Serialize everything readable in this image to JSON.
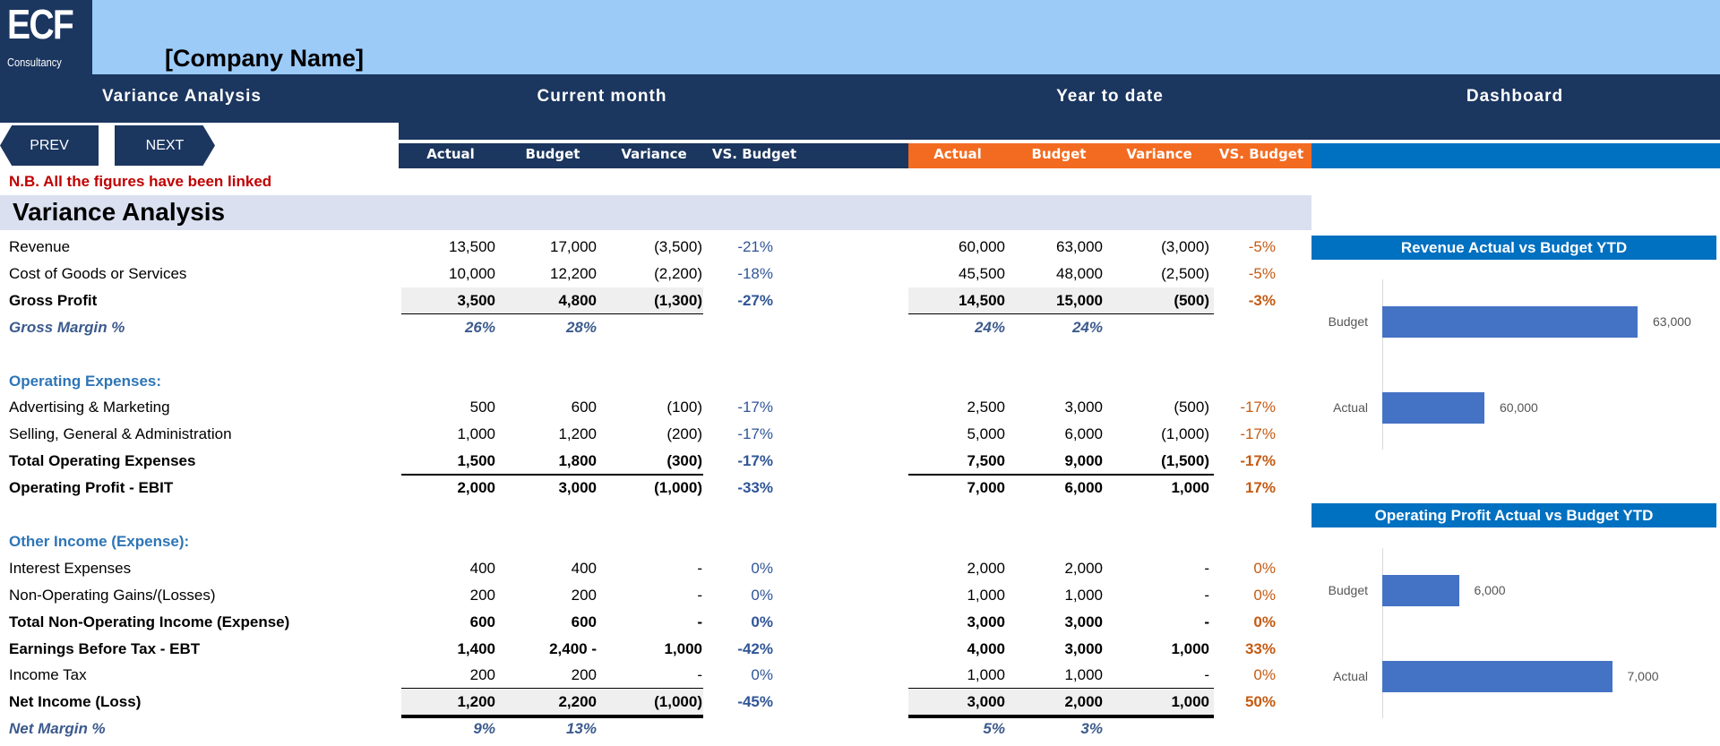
{
  "logo": {
    "big": "ECF",
    "small": "Consultancy"
  },
  "company_name": "[Company Name]",
  "nav": {
    "variance_analysis": "Variance Analysis",
    "current_month": "Current month",
    "year_to_date": "Year to date",
    "dashboard": "Dashboard"
  },
  "buttons": {
    "prev": "PREV",
    "next": "NEXT"
  },
  "column_headers": {
    "current_month": [
      "Actual",
      "Budget",
      "Variance",
      "VS. Budget"
    ],
    "year_to_date": [
      "Actual",
      "Budget",
      "Variance",
      "VS. Budget"
    ]
  },
  "note": "N.B. All the figures have been linked",
  "section_title": "Variance Analysis",
  "colors": {
    "navy": "#1b365f",
    "orange": "#f26b21",
    "blue": "#0070c0",
    "bar": "#4472c4",
    "note_red": "#c00000"
  },
  "rows": [
    {
      "label": "Revenue",
      "style": "normal",
      "cm": [
        "13,500",
        "17,000",
        "(3,500)",
        "-21%"
      ],
      "ytd": [
        "60,000",
        "63,000",
        "(3,000)",
        "-5%"
      ]
    },
    {
      "label": "Cost of Goods or Services",
      "style": "normal",
      "cm": [
        "10,000",
        "12,200",
        "(2,200)",
        "-18%"
      ],
      "ytd": [
        "45,500",
        "48,000",
        "(2,500)",
        "-5%"
      ]
    },
    {
      "label": "Gross Profit",
      "style": "bold",
      "shade": true,
      "underline": "single",
      "cm": [
        "3,500",
        "4,800",
        "(1,300)",
        "-27%"
      ],
      "ytd": [
        "14,500",
        "15,000",
        "(500)",
        "-3%"
      ]
    },
    {
      "label": "Gross Margin %",
      "style": "margin",
      "cm": [
        "26%",
        "28%",
        "",
        ""
      ],
      "ytd": [
        "24%",
        "24%",
        "",
        ""
      ]
    },
    {
      "label": "",
      "style": "blank"
    },
    {
      "label": "Operating Expenses:",
      "style": "section-hdr"
    },
    {
      "label": "Advertising & Marketing",
      "style": "normal",
      "cm": [
        "500",
        "600",
        "(100)",
        "-17%"
      ],
      "ytd": [
        "2,500",
        "3,000",
        "(500)",
        "-17%"
      ]
    },
    {
      "label": "Selling, General & Administration",
      "style": "normal",
      "cm": [
        "1,000",
        "1,200",
        "(200)",
        "-17%"
      ],
      "ytd": [
        "5,000",
        "6,000",
        "(1,000)",
        "-17%"
      ]
    },
    {
      "label": "Total Operating Expenses",
      "style": "bold",
      "underline": "single",
      "cm": [
        "1,500",
        "1,800",
        "(300)",
        "-17%"
      ],
      "ytd": [
        "7,500",
        "9,000",
        "(1,500)",
        "-17%"
      ]
    },
    {
      "label": "Operating Profit - EBIT",
      "style": "bold",
      "cm": [
        "2,000",
        "3,000",
        "(1,000)",
        "-33%"
      ],
      "ytd": [
        "7,000",
        "6,000",
        "1,000",
        "17%"
      ]
    },
    {
      "label": "",
      "style": "blank"
    },
    {
      "label": "Other Income (Expense):",
      "style": "section-hdr"
    },
    {
      "label": "Interest Expenses",
      "style": "normal",
      "cm": [
        "400",
        "400",
        "-",
        "0%"
      ],
      "ytd": [
        "2,000",
        "2,000",
        "-",
        "0%"
      ]
    },
    {
      "label": "Non-Operating Gains/(Losses)",
      "style": "normal",
      "cm": [
        "200",
        "200",
        "-",
        "0%"
      ],
      "ytd": [
        "1,000",
        "1,000",
        "-",
        "0%"
      ]
    },
    {
      "label": "Total Non-Operating Income (Expense)",
      "style": "bold",
      "cm": [
        "600",
        "600",
        "-",
        "0%"
      ],
      "ytd": [
        "3,000",
        "3,000",
        "-",
        "0%"
      ]
    },
    {
      "label": "Earnings Before Tax - EBT",
      "style": "bold",
      "cm": [
        "1,400",
        "2,400 -",
        "1,000",
        "-42%"
      ],
      "ytd": [
        "4,000",
        "3,000",
        "1,000",
        "33%"
      ]
    },
    {
      "label": "Income Tax",
      "style": "normal",
      "underline": "single",
      "cm": [
        "200",
        "200",
        "-",
        "0%"
      ],
      "ytd": [
        "1,000",
        "1,000",
        "-",
        "0%"
      ]
    },
    {
      "label": "Net Income (Loss)",
      "style": "bold",
      "shade": true,
      "underline": "thick",
      "cm": [
        "1,200",
        "2,200",
        "(1,000)",
        "-45%"
      ],
      "ytd": [
        "3,000",
        "2,000",
        "1,000",
        "50%"
      ]
    },
    {
      "label": "Net Margin %",
      "style": "margin",
      "cm": [
        "9%",
        "13%",
        "",
        ""
      ],
      "ytd": [
        "5%",
        "3%",
        "",
        ""
      ]
    }
  ],
  "chart_data": [
    {
      "type": "bar",
      "orientation": "horizontal",
      "title": "Revenue Actual vs Budget YTD",
      "categories": [
        "Budget",
        "Actual"
      ],
      "values": [
        63000,
        60000
      ],
      "labels": [
        "63,000",
        "60,000"
      ],
      "xlim": [
        58000,
        64000
      ],
      "grid": false
    },
    {
      "type": "bar",
      "orientation": "horizontal",
      "title": "Operating Profit Actual vs Budget YTD",
      "categories": [
        "Budget",
        "Actual"
      ],
      "values": [
        6000,
        7000
      ],
      "labels": [
        "6,000",
        "7,000"
      ],
      "xlim": [
        5500,
        7500
      ],
      "grid": false
    }
  ]
}
